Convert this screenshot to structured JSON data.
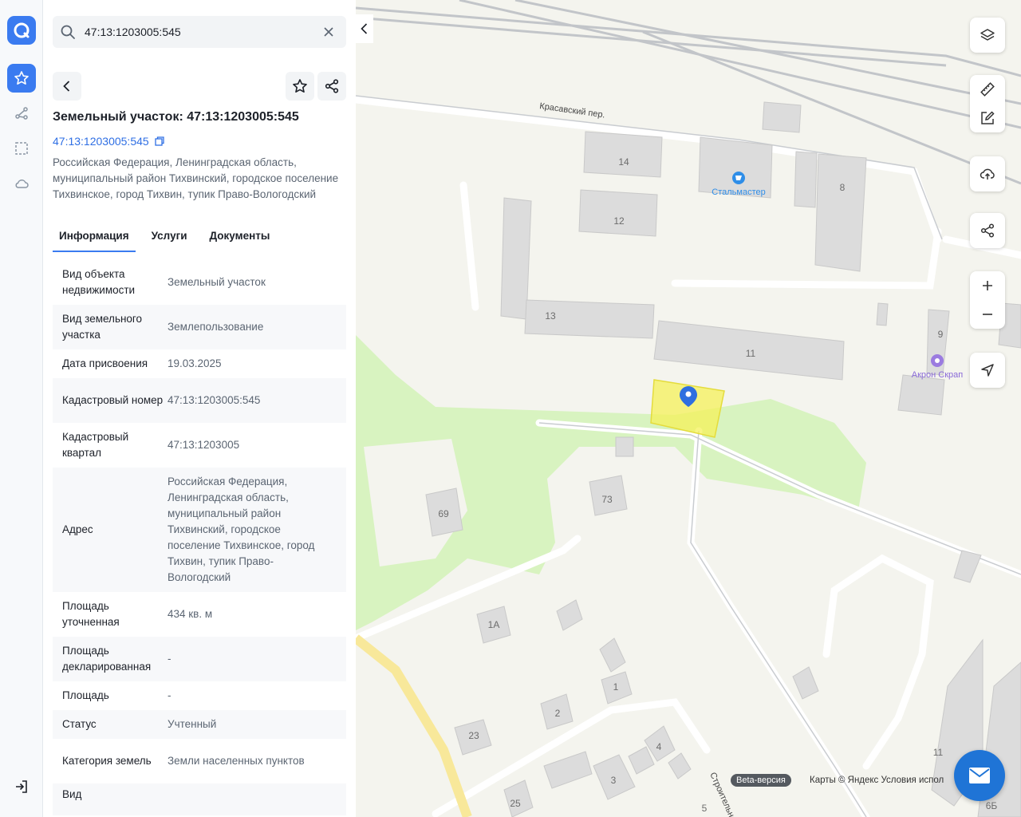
{
  "search": {
    "value": "47:13:1203005:545"
  },
  "card": {
    "title": "Земельный участок: 47:13:1203005:545",
    "cad_link": "47:13:1203005:545",
    "address": "Российская Федерация, Ленинградская область, муниципальный район Тихвинский, городское поселение Тихвинское, город Тихвин, тупик Право-Вологодский"
  },
  "tabs": [
    {
      "label": "Информация",
      "active": true
    },
    {
      "label": "Услуги"
    },
    {
      "label": "Документы"
    }
  ],
  "props": [
    {
      "k": "Вид объекта недвижимости",
      "v": "Земельный участок"
    },
    {
      "k": "Вид земельного участка",
      "v": "Землепользование"
    },
    {
      "k": "Дата присвоения",
      "v": "19.03.2025"
    },
    {
      "k": "Кадастровый номер",
      "v": "47:13:1203005:545"
    },
    {
      "k": "Кадастровый квартал",
      "v": "47:13:1203005"
    },
    {
      "k": "Адрес",
      "v": "Российская Федерация, Ленинградская область, муниципальный район Тихвинский, городское поселение Тихвинское, город Тихвин, тупик Право-Вологодский"
    },
    {
      "k": "Площадь уточненная",
      "v": "434 кв. м"
    },
    {
      "k": "Площадь декларированная",
      "v": "-"
    },
    {
      "k": "Площадь",
      "v": "-"
    },
    {
      "k": "Статус",
      "v": "Учтенный"
    },
    {
      "k": "Категория земель",
      "v": "Земли населенных пунктов"
    },
    {
      "k": "Вид",
      "v": ""
    }
  ],
  "map": {
    "street": "Красавский пер.",
    "street2": "Строительная",
    "poi": [
      "Стальмастер",
      "Акрон Скрап"
    ],
    "buildings": [
      "14",
      "12",
      "13",
      "11",
      "8",
      "9",
      "73",
      "69",
      "1А",
      "1",
      "2",
      "23",
      "4",
      "3",
      "25",
      "5",
      "11",
      "6Б"
    ],
    "beta": "Beta-версия",
    "copyright": "Карты © Яндекс   Условия испол"
  },
  "colors": {
    "accent": "#3a7bf0",
    "parcel": "#f5f25a",
    "park": "#d8f3c0"
  }
}
